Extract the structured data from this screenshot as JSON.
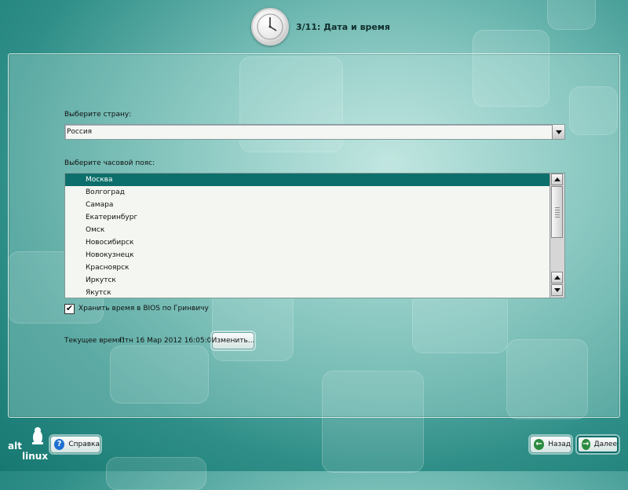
{
  "window": {
    "title": "3/11: Дата и время"
  },
  "country": {
    "label": "Выберите страну:",
    "value": "Россия"
  },
  "timezone": {
    "label": "Выберите часовой пояс:",
    "items": [
      "Москва",
      "Волгоград",
      "Самара",
      "Екатеринбург",
      "Омск",
      "Новосибирск",
      "Новокузнецк",
      "Красноярск",
      "Иркутск",
      "Якутск"
    ],
    "selected_index": 0
  },
  "bios": {
    "label": "Хранить время в BIOS по Гринвичу",
    "checked": true
  },
  "current_time": {
    "label": "Текущее время:",
    "value": "Птн 16 Мар 2012 16:05:04",
    "change_label": "Изменить..."
  },
  "footer": {
    "logo_alt": "alt",
    "logo_linux": "linux",
    "help_label": "Справка",
    "back_label": "Назад",
    "next_label": "Далее"
  },
  "colors": {
    "accent": "#0d6f6b",
    "background": "#2f8f88"
  },
  "icons": [
    "clock-icon",
    "help-icon",
    "back-arrow-icon",
    "next-arrow-icon",
    "penguin-logo"
  ]
}
